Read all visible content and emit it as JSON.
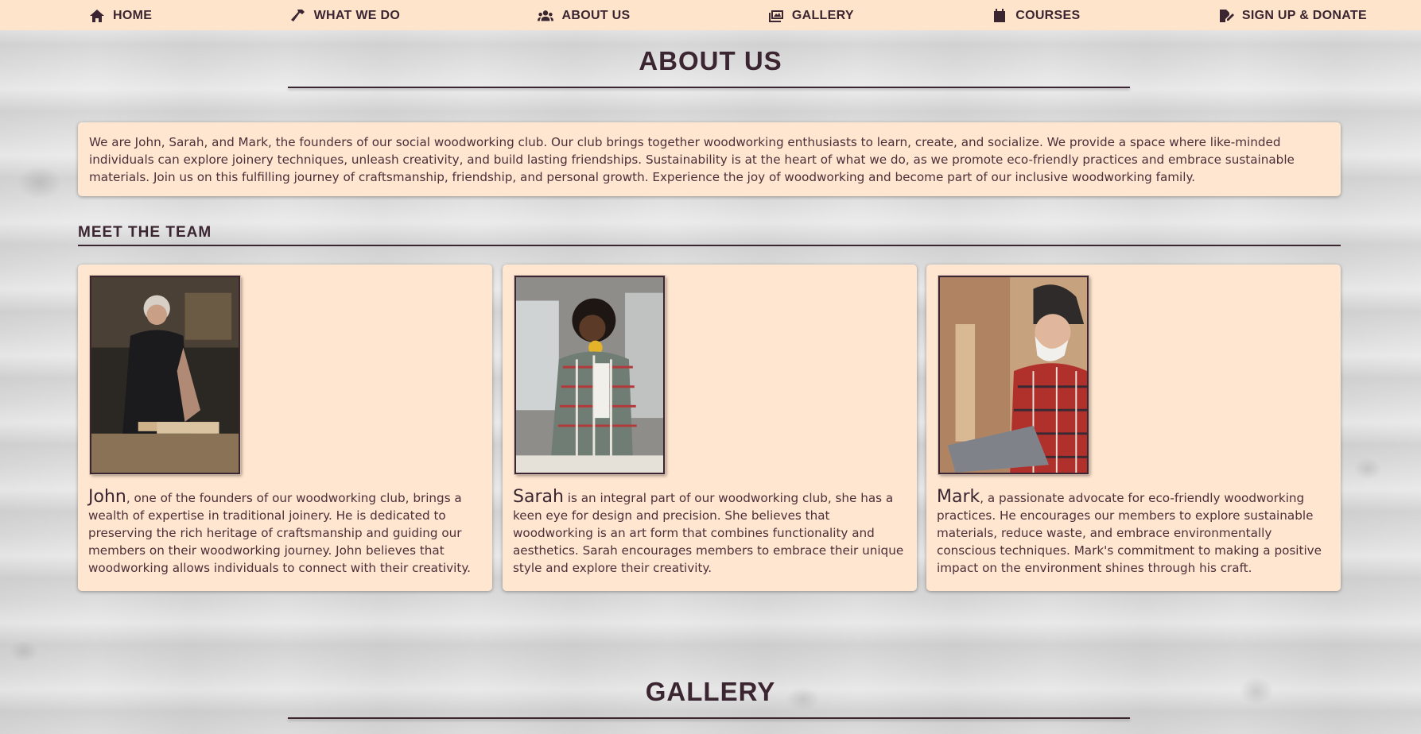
{
  "nav": {
    "items": [
      {
        "label": "HOME",
        "icon": "home-icon"
      },
      {
        "label": "WHAT WE DO",
        "icon": "hammer-icon"
      },
      {
        "label": "ABOUT US",
        "icon": "users-icon"
      },
      {
        "label": "GALLERY",
        "icon": "images-icon"
      },
      {
        "label": "COURSES",
        "icon": "calendar-icon"
      },
      {
        "label": "SIGN UP & DONATE",
        "icon": "signature-icon"
      }
    ]
  },
  "about": {
    "title": "ABOUT US",
    "intro": "We are John, Sarah, and Mark, the founders of our social woodworking club. Our club brings together woodworking enthusiasts to learn, create, and socialize. We provide a space where like-minded individuals can explore joinery techniques, unleash creativity, and build lasting friendships. Sustainability is at the heart of what we do, as we promote eco-friendly practices and embrace sustainable materials. Join us on this fulfilling journey of craftsmanship, friendship, and personal growth. Experience the joy of woodworking and become part of our inclusive woodworking family."
  },
  "team": {
    "heading": "MEET THE TEAM",
    "members": [
      {
        "name": "John",
        "bio": ", one of the founders of our woodworking club, brings a wealth of expertise in traditional joinery. He is dedicated to preserving the rich heritage of craftsmanship and guiding our members on their woodworking journey. John believes that woodworking allows individuals to connect with their creativity."
      },
      {
        "name": "Sarah",
        "bio": " is an integral part of our woodworking club, she has a keen eye for design and precision. She believes that woodworking is an art form that combines functionality and aesthetics. Sarah encourages members to embrace their unique style and explore their creativity."
      },
      {
        "name": "Mark",
        "bio": ", a passionate advocate for eco-friendly woodworking practices. He encourages our members to explore sustainable materials, reduce waste, and embrace environmentally conscious techniques. Mark's commitment to making a positive impact on the environment shines through his craft."
      }
    ]
  },
  "gallery": {
    "title": "GALLERY"
  },
  "colors": {
    "nav_bg": "#ffe4cc",
    "card_bg": "#ffe6d0",
    "text": "#3a2530"
  }
}
